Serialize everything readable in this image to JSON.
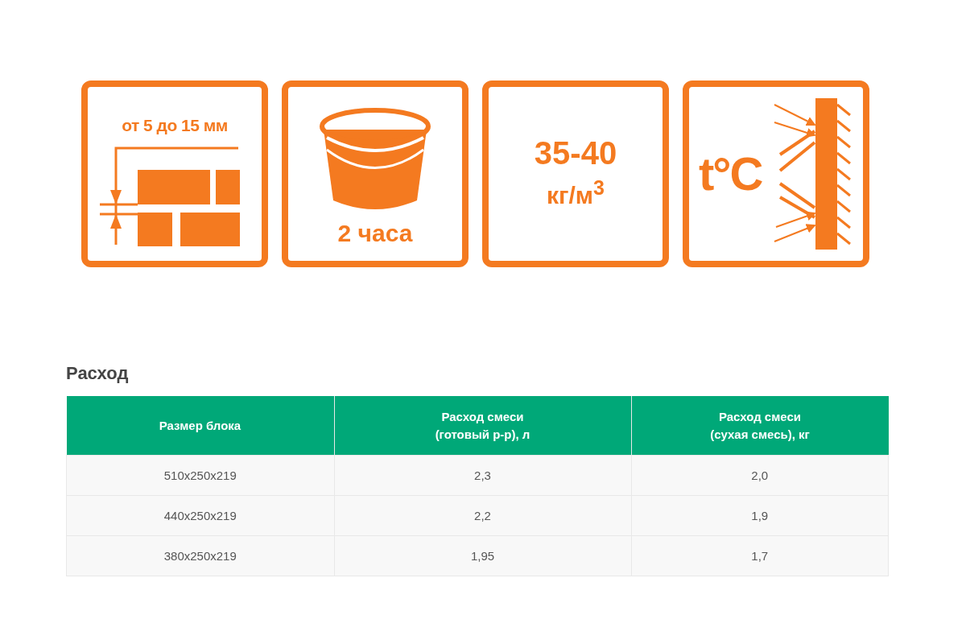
{
  "features": [
    {
      "kind": "joint",
      "lines": [
        "от 5 до 15 мм"
      ]
    },
    {
      "kind": "bucket",
      "lines": [
        "2 часа"
      ]
    },
    {
      "kind": "density",
      "lines": [
        "35-40",
        "кг/м$^{3}$"
      ]
    },
    {
      "kind": "temperature",
      "lines": [
        "t°C"
      ]
    }
  ],
  "consumption": {
    "title": "Расход",
    "columns": [
      "Размер блока",
      "Расход смеси\n(готовый р-р), л",
      "Расход смеси\n(сухая смесь), кг"
    ],
    "rows": [
      [
        "510x250x219",
        "2,3",
        "2,0"
      ],
      [
        "440x250x219",
        "2,2",
        "1,9"
      ],
      [
        "380x250x219",
        "1,95",
        "1,7"
      ]
    ]
  }
}
